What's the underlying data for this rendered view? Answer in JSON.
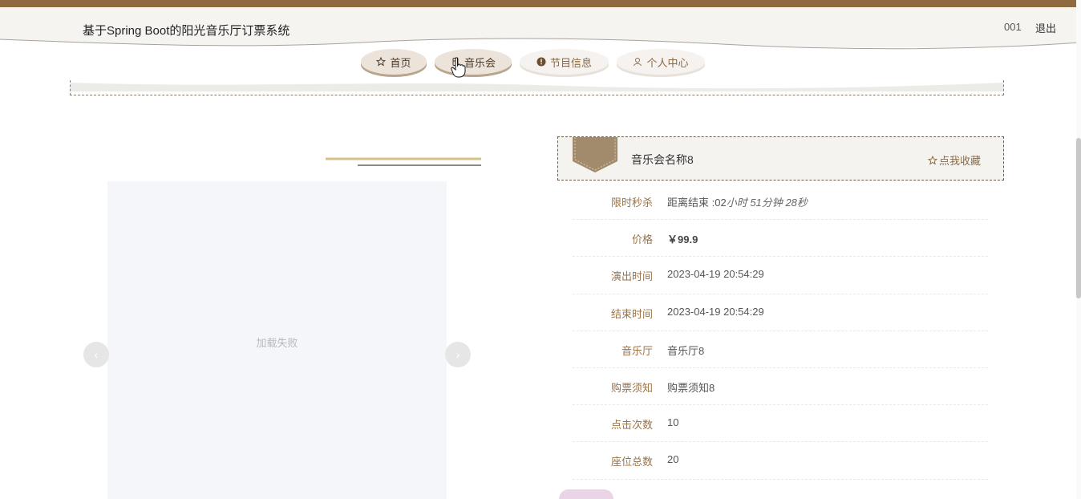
{
  "header": {
    "site_title": "基于Spring Boot的阳光音乐厅订票系统",
    "user_name": "001",
    "logout_label": "退出"
  },
  "nav": {
    "items": [
      {
        "label": "首页",
        "icon": "star-icon"
      },
      {
        "label": "音乐会",
        "icon": "ticket-icon"
      },
      {
        "label": "节目信息",
        "icon": "info-circle-icon"
      },
      {
        "label": "个人中心",
        "icon": "user-icon"
      }
    ]
  },
  "gallery": {
    "error_text": "加载失败",
    "prev_arrow": "‹",
    "next_arrow": "›"
  },
  "detail": {
    "title": "音乐会名称8",
    "favorite_label": "点我收藏",
    "flash_sale": {
      "label": "限时秒杀",
      "prefix": "距离结束 :02",
      "hours_unit": "小时",
      "minutes": "51",
      "minutes_unit": "分钟",
      "seconds": "28",
      "seconds_unit": "秒"
    },
    "price": {
      "label": "价格",
      "value": "￥99.9"
    },
    "start_time": {
      "label": "演出时间",
      "value": "2023-04-19 20:54:29"
    },
    "end_time": {
      "label": "结束时间",
      "value": "2023-04-19 20:54:29"
    },
    "hall": {
      "label": "音乐厅",
      "value": "音乐厅8"
    },
    "notice": {
      "label": "购票须知",
      "value": "购票须知8"
    },
    "clicks": {
      "label": "点击次数",
      "value": "10"
    },
    "seats": {
      "label": "座位总数",
      "value": "20"
    }
  },
  "colors": {
    "accent": "#8f6a41",
    "label": "#9a7348",
    "header_bg": "#f5f4f1"
  }
}
